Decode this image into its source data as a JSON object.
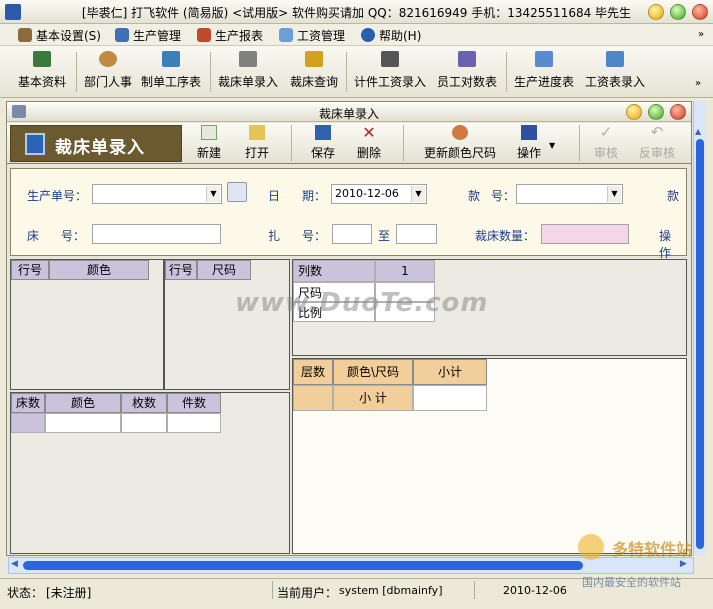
{
  "window": {
    "title": "[毕裘仁] 打飞软件 (简易版) <试用版> 软件购买请加 QQ：821616949 手机：13425511684 毕先生"
  },
  "menu": [
    {
      "label": "基本设置(S)",
      "icon": "settings-icon"
    },
    {
      "label": "生产管理",
      "icon": "factory-icon"
    },
    {
      "label": "生产报表",
      "icon": "report-icon"
    },
    {
      "label": "工资管理",
      "icon": "salary-icon"
    },
    {
      "label": "帮助(H)",
      "icon": "help-icon"
    }
  ],
  "toolbar": [
    {
      "label": "基本资料"
    },
    {
      "label": "部门人事"
    },
    {
      "label": "制单工序表"
    },
    {
      "label": "裁床单录入"
    },
    {
      "label": "裁床查询"
    },
    {
      "label": "计件工资录入"
    },
    {
      "label": "员工对数表"
    },
    {
      "label": "生产进度表"
    },
    {
      "label": "工资表录入"
    }
  ],
  "child": {
    "title": "裁床单录入",
    "header_title": "裁床单录入",
    "actions": {
      "new": "新建",
      "open": "打开",
      "save": "保存",
      "delete": "删除",
      "refresh": "更新颜色尺码",
      "operate": "操作",
      "approve": "审核",
      "unapprove": "反审核"
    },
    "form": {
      "order_label": "生产单号：",
      "date_label_1": "日",
      "date_label_2": "期：",
      "date_value": "2010-12-06",
      "style_label_1": "款",
      "style_label_2": "号：",
      "style_label_3": "款",
      "bed_label_1": "床",
      "bed_label_2": "号：",
      "bundle_label_1": "扎",
      "bundle_label_2": "号：",
      "to_label": "至",
      "qty_label": "裁床数量：",
      "op_label": "操 作"
    },
    "grid_color": {
      "headers": [
        "行号",
        "颜色"
      ]
    },
    "grid_size": {
      "headers": [
        "行号",
        "尺码"
      ]
    },
    "grid_ratio": {
      "col_label": "列数",
      "col_value": "1",
      "size_label": "尺码",
      "ratio_label": "比例"
    },
    "grid_layers": {
      "headers": [
        "床数",
        "颜色",
        "枚数",
        "件数"
      ]
    },
    "grid_summary": {
      "headers": [
        "层数",
        "颜色\\尺码",
        "小计"
      ],
      "subtotal_label": "小 计"
    }
  },
  "watermark": {
    "text": "www.DuoTe.com",
    "brand": "多特软件站",
    "slogan": "国内最安全的软件站"
  },
  "status": {
    "state_label": "状态：",
    "state_value": "[未注册]",
    "user_label": "当前用户：",
    "user_value": "system [dbmainfy]",
    "date": "2010-12-06"
  }
}
